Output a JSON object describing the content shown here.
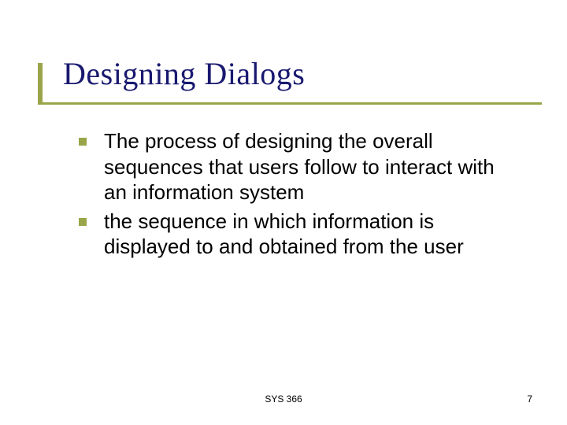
{
  "slide": {
    "title": "Designing Dialogs",
    "bullets": [
      "The process of designing the overall sequences that users follow to interact with an information system",
      "the sequence in which information is displayed to and obtained from the user"
    ],
    "footer": "SYS 366",
    "page": "7"
  }
}
